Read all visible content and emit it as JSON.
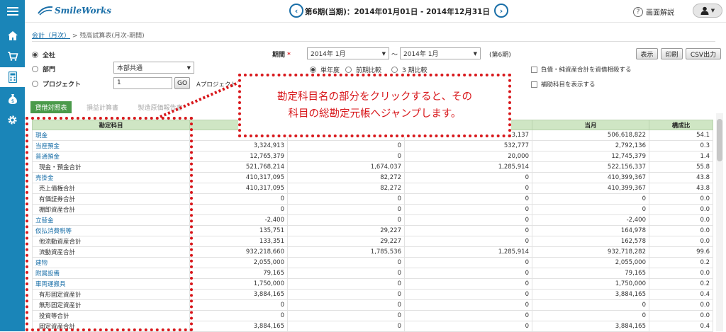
{
  "app": {
    "logo": "SmileWorks"
  },
  "header": {
    "period": "第6期(当期)：2014年01月01日 - 2014年12月31日",
    "help": "画面解説"
  },
  "breadcrumb": {
    "parent": "会計（月次）",
    "separator": ">",
    "current": "残高試算表(月次-期間)"
  },
  "filters": {
    "scope_options": [
      "全社",
      "部門",
      "プロジェクト"
    ],
    "dept_value": "本部共通",
    "project_value": "1",
    "go_label": "GO",
    "project_link": "Aプロジェクト",
    "period_label": "期間",
    "required_mark": "*",
    "period_from": "2014年 1月",
    "period_tilde": "〜",
    "period_to": "2014年 1月",
    "period_term": "(第6期)",
    "compare_options": [
      "単年度",
      "前期比較",
      "3 期比較"
    ],
    "check1": "負債・純資産合計を資借相殺する",
    "check2": "補助科目を表示する"
  },
  "actions": {
    "display": "表示",
    "print": "印刷",
    "csv": "CSV出力"
  },
  "tabs": [
    "貸借対照表",
    "損益計算書",
    "製造原価報告書"
  ],
  "table": {
    "headers": [
      "勘定科目",
      "",
      "",
      "",
      "当月",
      "構成比"
    ],
    "rows": [
      {
        "name": "現金",
        "link": true,
        "sub": false,
        "c1": "",
        "c2": "",
        "c3": "33,137",
        "cur": "506,618,822",
        "ratio": "54.1"
      },
      {
        "name": "当座預金",
        "link": true,
        "sub": false,
        "c1": "3,324,913",
        "c2": "0",
        "c3": "532,777",
        "cur": "2,792,136",
        "ratio": "0.3"
      },
      {
        "name": "普通預金",
        "link": true,
        "sub": false,
        "c1": "12,765,379",
        "c2": "0",
        "c3": "20,000",
        "cur": "12,745,379",
        "ratio": "1.4"
      },
      {
        "name": "現金・預金合計",
        "link": false,
        "sub": true,
        "c1": "521,768,214",
        "c2": "1,674,037",
        "c3": "1,285,914",
        "cur": "522,156,337",
        "ratio": "55.8"
      },
      {
        "name": "売掛金",
        "link": true,
        "sub": false,
        "c1": "410,317,095",
        "c2": "82,272",
        "c3": "0",
        "cur": "410,399,367",
        "ratio": "43.8"
      },
      {
        "name": "売上債権合計",
        "link": false,
        "sub": true,
        "c1": "410,317,095",
        "c2": "82,272",
        "c3": "0",
        "cur": "410,399,367",
        "ratio": "43.8"
      },
      {
        "name": "有価証券合計",
        "link": false,
        "sub": true,
        "c1": "0",
        "c2": "0",
        "c3": "0",
        "cur": "0",
        "ratio": "0.0"
      },
      {
        "name": "棚卸資産合計",
        "link": false,
        "sub": true,
        "c1": "0",
        "c2": "0",
        "c3": "0",
        "cur": "0",
        "ratio": "0.0"
      },
      {
        "name": "立替金",
        "link": true,
        "sub": false,
        "c1": "-2,400",
        "c2": "0",
        "c3": "0",
        "cur": "-2,400",
        "ratio": "0.0"
      },
      {
        "name": "仮払消費税等",
        "link": true,
        "sub": false,
        "c1": "135,751",
        "c2": "29,227",
        "c3": "0",
        "cur": "164,978",
        "ratio": "0.0"
      },
      {
        "name": "他流動資産合計",
        "link": false,
        "sub": true,
        "c1": "133,351",
        "c2": "29,227",
        "c3": "0",
        "cur": "162,578",
        "ratio": "0.0"
      },
      {
        "name": "流動資産合計",
        "link": false,
        "sub": true,
        "c1": "932,218,660",
        "c2": "1,785,536",
        "c3": "1,285,914",
        "cur": "932,718,282",
        "ratio": "99.6"
      },
      {
        "name": "建物",
        "link": true,
        "sub": false,
        "c1": "2,055,000",
        "c2": "0",
        "c3": "0",
        "cur": "2,055,000",
        "ratio": "0.2"
      },
      {
        "name": "附属設備",
        "link": true,
        "sub": false,
        "c1": "79,165",
        "c2": "0",
        "c3": "0",
        "cur": "79,165",
        "ratio": "0.0"
      },
      {
        "name": "車両運搬具",
        "link": true,
        "sub": false,
        "c1": "1,750,000",
        "c2": "0",
        "c3": "0",
        "cur": "1,750,000",
        "ratio": "0.2"
      },
      {
        "name": "有形固定資産計",
        "link": false,
        "sub": true,
        "c1": "3,884,165",
        "c2": "0",
        "c3": "0",
        "cur": "3,884,165",
        "ratio": "0.4"
      },
      {
        "name": "無形固定資産計",
        "link": false,
        "sub": true,
        "c1": "0",
        "c2": "0",
        "c3": "0",
        "cur": "0",
        "ratio": "0.0"
      },
      {
        "name": "投資等合計",
        "link": false,
        "sub": true,
        "c1": "0",
        "c2": "0",
        "c3": "0",
        "cur": "0",
        "ratio": "0.0"
      },
      {
        "name": "固定資産合計",
        "link": false,
        "sub": true,
        "c1": "3,884,165",
        "c2": "0",
        "c3": "0",
        "cur": "3,884,165",
        "ratio": "0.4"
      }
    ]
  },
  "annotation": {
    "line1": "勘定科目名の部分をクリックすると、その",
    "line2": "科目の総勘定元帳へジャンプします。"
  },
  "colors": {
    "sidebar": "#1a85b8",
    "accent": "#1a6fa8",
    "annotation": "#d8181c",
    "tab_active": "#4a9a4a",
    "table_header": "#cfe6c4"
  },
  "icons": [
    "menu-icon",
    "home-icon",
    "cart-icon",
    "calculator-icon",
    "money-bag-icon",
    "gear-icon",
    "prev-period-icon",
    "next-period-icon",
    "help-icon",
    "user-icon"
  ]
}
